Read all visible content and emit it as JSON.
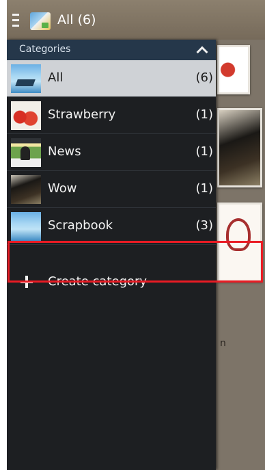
{
  "app_bar": {
    "title": "All (6)"
  },
  "drawer": {
    "header": "Categories",
    "categories": [
      {
        "name": "All",
        "count": "(6)",
        "selected": true
      },
      {
        "name": "Strawberry",
        "count": "(1)"
      },
      {
        "name": "News",
        "count": "(1)"
      },
      {
        "name": "Wow",
        "count": "(1)"
      },
      {
        "name": "Scrapbook",
        "count": "(3)"
      }
    ],
    "create_label": "Create category"
  },
  "background": {
    "caption_fragment": "n"
  },
  "colors": {
    "highlight": "#ea1b24",
    "drawer_bg": "#1d1f22",
    "header_bg": "#25374a",
    "selected_bg": "#cfd2d6"
  }
}
